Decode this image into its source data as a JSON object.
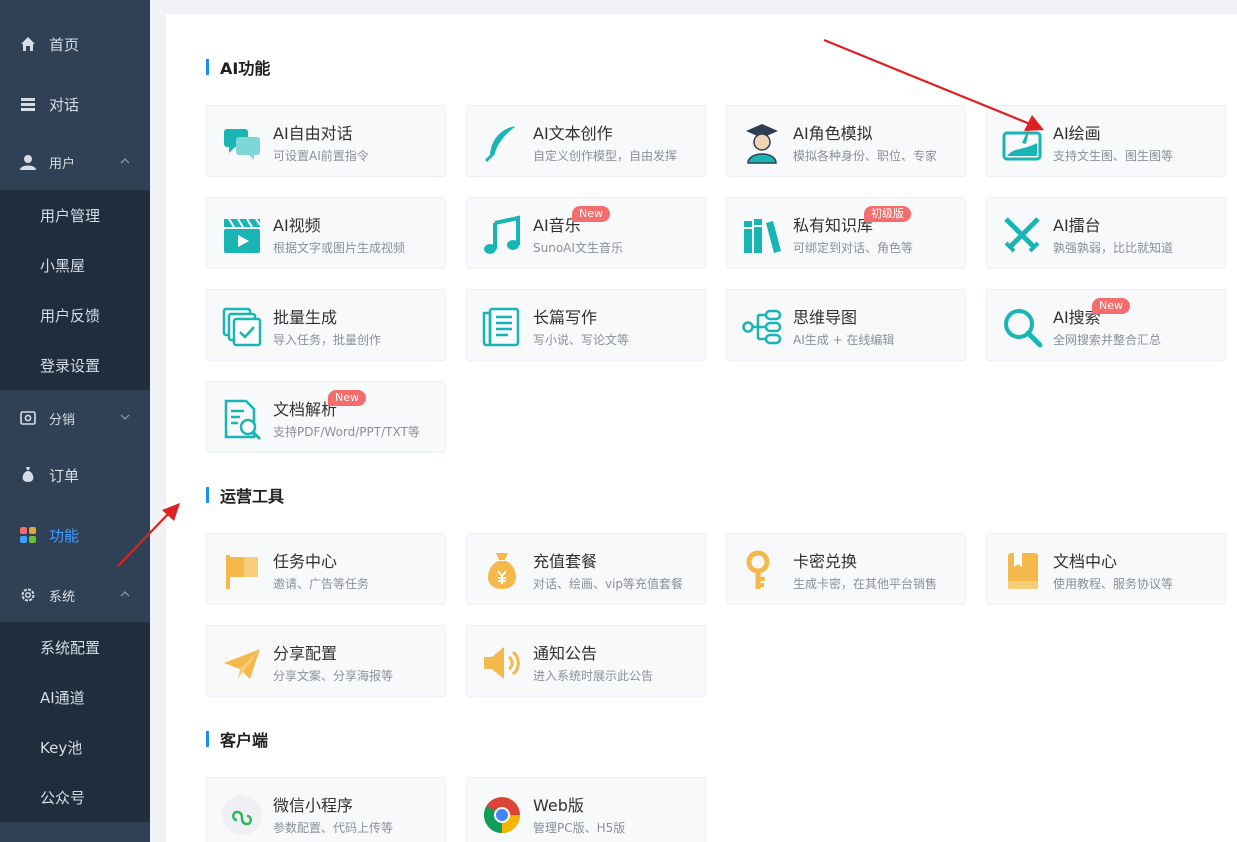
{
  "sidebar": {
    "items": {
      "home": "首页",
      "chat": "对话",
      "user": "用户",
      "distribution": "分销",
      "order": "订单",
      "feature": "功能",
      "system": "系统"
    },
    "user_sub": [
      "用户管理",
      "小黑屋",
      "用户反馈",
      "登录设置"
    ],
    "system_sub": [
      "系统配置",
      "AI通道",
      "Key池",
      "公众号"
    ]
  },
  "sections": {
    "ai": "AI功能",
    "ops": "运营工具",
    "client": "客户端"
  },
  "cards": {
    "ai_chat": {
      "title": "AI自由对话",
      "desc": "可设置AI前置指令"
    },
    "ai_text": {
      "title": "AI文本创作",
      "desc": "自定义创作模型，自由发挥"
    },
    "ai_role": {
      "title": "AI角色模拟",
      "desc": "模拟各种身份、职位、专家"
    },
    "ai_draw": {
      "title": "AI绘画",
      "desc": "支持文生图、图生图等"
    },
    "ai_video": {
      "title": "AI视频",
      "desc": "根据文字或图片生成视频"
    },
    "ai_music": {
      "title": "AI音乐",
      "desc": "SunoAI文生音乐",
      "badge": "New"
    },
    "knowledge": {
      "title": "私有知识库",
      "desc": "可绑定到对话、角色等",
      "badge": "初级版"
    },
    "arena": {
      "title": "AI擂台",
      "desc": "孰强孰弱，比比就知道"
    },
    "batch": {
      "title": "批量生成",
      "desc": "导入任务，批量创作"
    },
    "long_write": {
      "title": "长篇写作",
      "desc": "写小说、写论文等"
    },
    "mindmap": {
      "title": "思维导图",
      "desc": "AI生成 + 在线编辑"
    },
    "ai_search": {
      "title": "AI搜索",
      "desc": "全网搜索并整合汇总",
      "badge": "New"
    },
    "doc_parse": {
      "title": "文档解析",
      "desc": "支持PDF/Word/PPT/TXT等",
      "badge": "New"
    },
    "task": {
      "title": "任务中心",
      "desc": "邀请、广告等任务"
    },
    "recharge": {
      "title": "充值套餐",
      "desc": "对话、绘画、vip等充值套餐"
    },
    "card_key": {
      "title": "卡密兑换",
      "desc": "生成卡密，在其他平台销售"
    },
    "doc_center": {
      "title": "文档中心",
      "desc": "使用教程、服务协议等"
    },
    "share": {
      "title": "分享配置",
      "desc": "分享文案、分享海报等"
    },
    "notice": {
      "title": "通知公告",
      "desc": "进入系统时展示此公告"
    },
    "wechat": {
      "title": "微信小程序",
      "desc": "参数配置、代码上传等"
    },
    "web": {
      "title": "Web版",
      "desc": "管理PC版、H5版"
    }
  },
  "colors": {
    "sidebar_bg": "#304156",
    "submenu_bg": "#1f2d3d",
    "accent": "#409eff",
    "teal": "#19b4b4",
    "amber": "#f5b84b",
    "badge": "#f56c6c",
    "arrow": "#e02020"
  }
}
